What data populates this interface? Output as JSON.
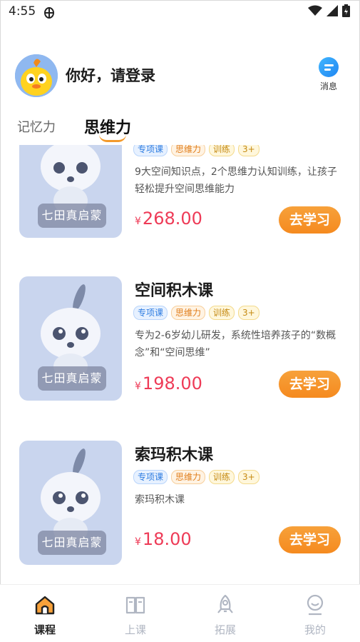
{
  "status_bar": {
    "time": "4:55"
  },
  "header": {
    "greeting": "你好，请登录",
    "message_label": "消息"
  },
  "tabs": [
    {
      "label": "记忆力",
      "active": false
    },
    {
      "label": "思维力",
      "active": true
    }
  ],
  "courses": [
    {
      "title": "",
      "tags": [
        "专项课",
        "思维力",
        "训练",
        "3+"
      ],
      "description": "9大空间知识点，2个思维力认知训练，让孩子轻松提升空间思维能力",
      "currency": "¥",
      "price": "268.00",
      "button": "去学习",
      "thumb_badge": "七田真启蒙"
    },
    {
      "title": "空间积木课",
      "tags": [
        "专项课",
        "思维力",
        "训练",
        "3+"
      ],
      "description": "专为2-6岁幼儿研发，系统性培养孩子的“数概念”和“空间思维”",
      "currency": "¥",
      "price": "198.00",
      "button": "去学习",
      "thumb_badge": "七田真启蒙"
    },
    {
      "title": "索玛积木课",
      "tags": [
        "专项课",
        "思维力",
        "训练",
        "3+"
      ],
      "description": "索玛积木课",
      "currency": "¥",
      "price": "18.00",
      "button": "去学习",
      "thumb_badge": "七田真启蒙"
    }
  ],
  "bottom_nav": [
    {
      "label": "课程",
      "icon": "home-icon",
      "active": true
    },
    {
      "label": "上课",
      "icon": "book-icon",
      "active": false
    },
    {
      "label": "拓展",
      "icon": "rocket-icon",
      "active": false
    },
    {
      "label": "我的",
      "icon": "user-icon",
      "active": false
    }
  ],
  "colors": {
    "accent": "#f58a1f",
    "price": "#ee3b57",
    "thumb_bg": "#c9d5ee"
  }
}
